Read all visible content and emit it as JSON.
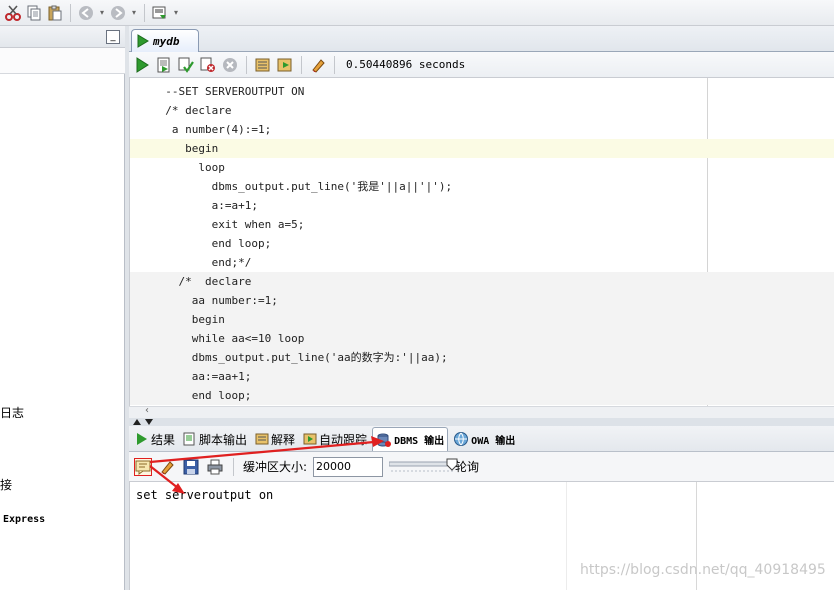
{
  "left_panel": {
    "partial_items": [
      "日志",
      "接",
      "Express"
    ],
    "minimize_label": "_"
  },
  "editor": {
    "tab_label": "mydb",
    "elapsed_time": "0.50440896 seconds",
    "code_lines": [
      "  --SET SERVEROUTPUT ON",
      "  /* declare",
      "   a number(4):=1;",
      "     begin",
      "       loop",
      "         dbms_output.put_line('我是'||a||'|');",
      "         a:=a+1;",
      "         exit when a=5;",
      "         end loop;",
      "         end;*/",
      "    /*  declare",
      "      aa number:=1;",
      "      begin",
      "      while aa<=10 loop",
      "      dbms_output.put_line('aa的数字为:'||aa);",
      "      aa:=aa+1;",
      "      end loop;"
    ]
  },
  "output_panel": {
    "tabs": [
      {
        "label": "结果",
        "icon": "play-icon"
      },
      {
        "label": "脚本输出",
        "icon": "script-icon"
      },
      {
        "label": "解释",
        "icon": "explain-icon"
      },
      {
        "label": "自动跟踪",
        "icon": "autotrace-icon"
      },
      {
        "label": "DBMS 输出",
        "icon": "dbms-icon",
        "active": true
      },
      {
        "label": "OWA 输出",
        "icon": "owa-icon"
      }
    ],
    "buffer_label": "缓冲区大小:",
    "buffer_value": "20000",
    "poll_label": "轮询",
    "output_text": "set serveroutput on"
  },
  "watermark": "https://blog.csdn.net/qq_40918495",
  "colors": {
    "run_green": "#2e9a2e",
    "annotation_red": "#e02020",
    "current_line": "#fbfbe4"
  }
}
